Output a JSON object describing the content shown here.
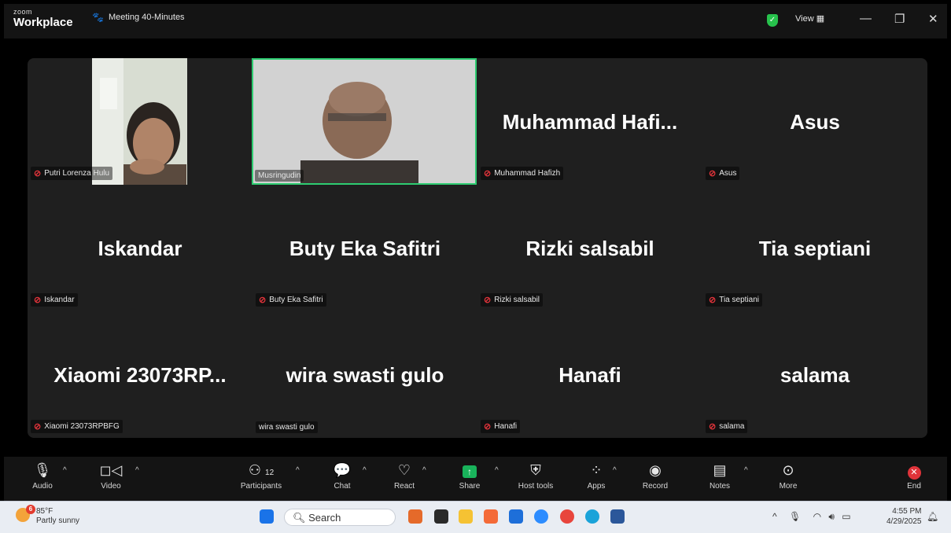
{
  "titlebar": {
    "brand_small": "zoom",
    "brand_main": "Workplace",
    "meeting_title": "Meeting 40-Minutes",
    "view_label": "View",
    "view_icon": "grid-icon"
  },
  "tiles": [
    {
      "label": "Putri Lorenza Hulu",
      "muted": true,
      "video": true
    },
    {
      "label": "Musringudin",
      "muted": false,
      "video": true,
      "active_speaker": true
    },
    {
      "name": "Muhammad  Hafi...",
      "label": "Muhammad Hafizh",
      "muted": true
    },
    {
      "name": "Asus",
      "label": "Asus",
      "muted": true
    },
    {
      "name": "Iskandar",
      "label": "Iskandar",
      "muted": true
    },
    {
      "name": "Buty Eka Safitri",
      "label": "Buty Eka Safitri",
      "muted": true
    },
    {
      "name": "Rizki salsabil",
      "label": "Rizki salsabil",
      "muted": true
    },
    {
      "name": "Tia septiani",
      "label": "Tia septiani",
      "muted": true
    },
    {
      "name": "Xiaomi  23073RP...",
      "label": "Xiaomi 23073RPBFG",
      "muted": true
    },
    {
      "name": "wira swasti gulo",
      "label": "wira swasti gulo",
      "muted": false
    },
    {
      "name": "Hanafi",
      "label": "Hanafi",
      "muted": true
    },
    {
      "name": "salama",
      "label": "salama",
      "muted": true
    }
  ],
  "toolbar": {
    "audio": "Audio",
    "video": "Video",
    "participants": "Participants",
    "participants_count": "12",
    "chat": "Chat",
    "react": "React",
    "share": "Share",
    "host_tools": "Host tools",
    "apps": "Apps",
    "record": "Record",
    "notes": "Notes",
    "more": "More",
    "end": "End",
    "accent_share": "#19b35b",
    "accent_end": "#e0333a"
  },
  "taskbar": {
    "temp": "85°F",
    "weather": "Partly sunny",
    "weather_badge": "6",
    "search_placeholder": "Search",
    "time": "4:55 PM",
    "date": "4/29/2025"
  }
}
